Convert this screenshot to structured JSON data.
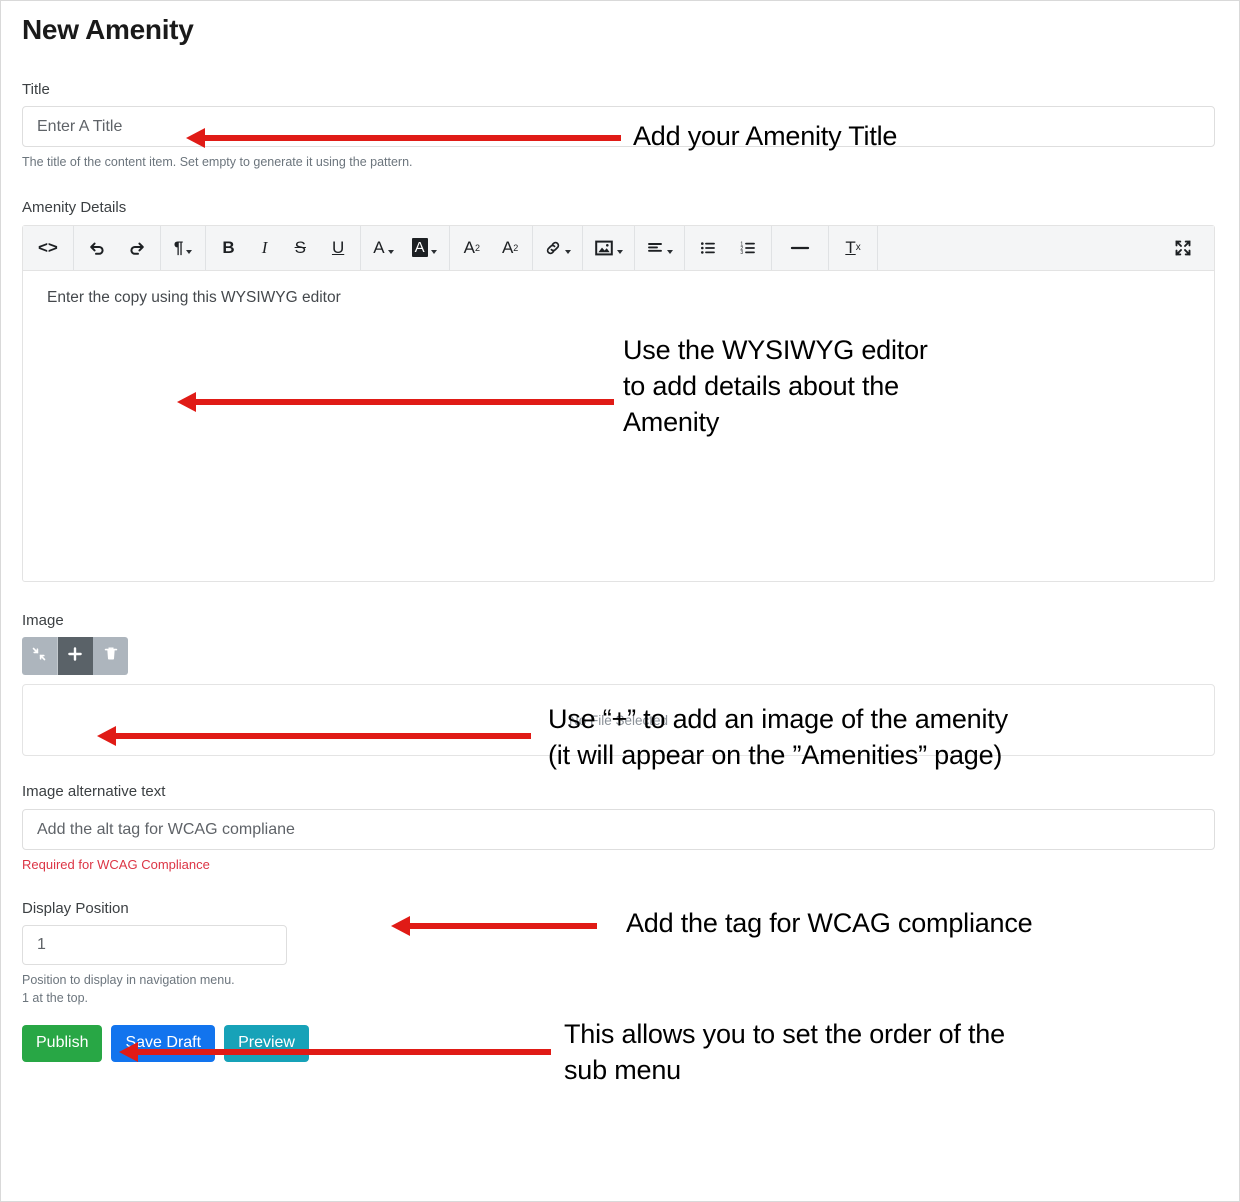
{
  "page": {
    "title": "New Amenity"
  },
  "fields": {
    "title": {
      "label": "Title",
      "value": "Enter A Title",
      "hint": "The title of the content item. Set empty to generate it using the pattern."
    },
    "amenity_details": {
      "label": "Amenity Details",
      "body_text": "Enter the copy using this WYSIWYG editor"
    },
    "image": {
      "label": "Image",
      "drop_text": "No File Selected"
    },
    "image_alt": {
      "label": "Image alternative text",
      "value": "Add the alt tag for WCAG compliane",
      "hint": "Required for WCAG Compliance"
    },
    "display_position": {
      "label": "Display Position",
      "value": "1",
      "hint": "Position to display in navigation menu.\n1 at the top."
    }
  },
  "editor_toolbar": {
    "buttons": [
      {
        "name": "source-code-icon",
        "glyph": "<>",
        "dropdown": false
      },
      {
        "name": "undo-icon",
        "glyph": "undo",
        "dropdown": false
      },
      {
        "name": "redo-icon",
        "glyph": "redo",
        "dropdown": false
      },
      {
        "name": "paragraph-format-icon",
        "glyph": "¶",
        "dropdown": true
      },
      {
        "name": "bold-icon",
        "glyph": "B",
        "dropdown": false
      },
      {
        "name": "italic-icon",
        "glyph": "I",
        "dropdown": false
      },
      {
        "name": "strikethrough-icon",
        "glyph": "S",
        "dropdown": false
      },
      {
        "name": "underline-icon",
        "glyph": "U",
        "dropdown": false
      },
      {
        "name": "text-color-icon",
        "glyph": "A",
        "dropdown": true
      },
      {
        "name": "background-color-icon",
        "glyph": "A",
        "dropdown": true
      },
      {
        "name": "superscript-icon",
        "glyph": "A²",
        "dropdown": false
      },
      {
        "name": "subscript-icon",
        "glyph": "A₂",
        "dropdown": false
      },
      {
        "name": "link-icon",
        "glyph": "link",
        "dropdown": true
      },
      {
        "name": "insert-image-icon",
        "glyph": "image",
        "dropdown": true
      },
      {
        "name": "align-icon",
        "glyph": "align",
        "dropdown": true
      },
      {
        "name": "unordered-list-icon",
        "glyph": "bullets",
        "dropdown": false
      },
      {
        "name": "ordered-list-icon",
        "glyph": "numbers",
        "dropdown": false
      },
      {
        "name": "horizontal-rule-icon",
        "glyph": "—",
        "dropdown": false
      },
      {
        "name": "clear-formatting-icon",
        "glyph": "Tx",
        "dropdown": false
      },
      {
        "name": "fullscreen-icon",
        "glyph": "expand",
        "dropdown": false
      }
    ]
  },
  "media_buttons": [
    {
      "name": "collapse-media-button",
      "icon": "collapse-arrows-icon"
    },
    {
      "name": "add-media-button",
      "icon": "plus-icon"
    },
    {
      "name": "delete-media-button",
      "icon": "trash-icon"
    }
  ],
  "actions": {
    "publish": "Publish",
    "save_draft": "Save Draft",
    "preview": "Preview"
  },
  "annotations": {
    "title": "Add your Amenity Title",
    "editor": "Use the WYSIWYG editor\nto add details about the\nAmenity",
    "image": "Use “+” to add an image of the amenity\n(it will appear on the ”Amenities” page)",
    "alt": "Add the tag for WCAG compliance",
    "position": "This allows you to set the order of the\nsub menu"
  },
  "colors": {
    "publish": "#28a745",
    "save_draft": "#1274ee",
    "preview": "#17a2b8",
    "annotation_arrow": "#e01b16",
    "error_text": "#dc3545"
  }
}
